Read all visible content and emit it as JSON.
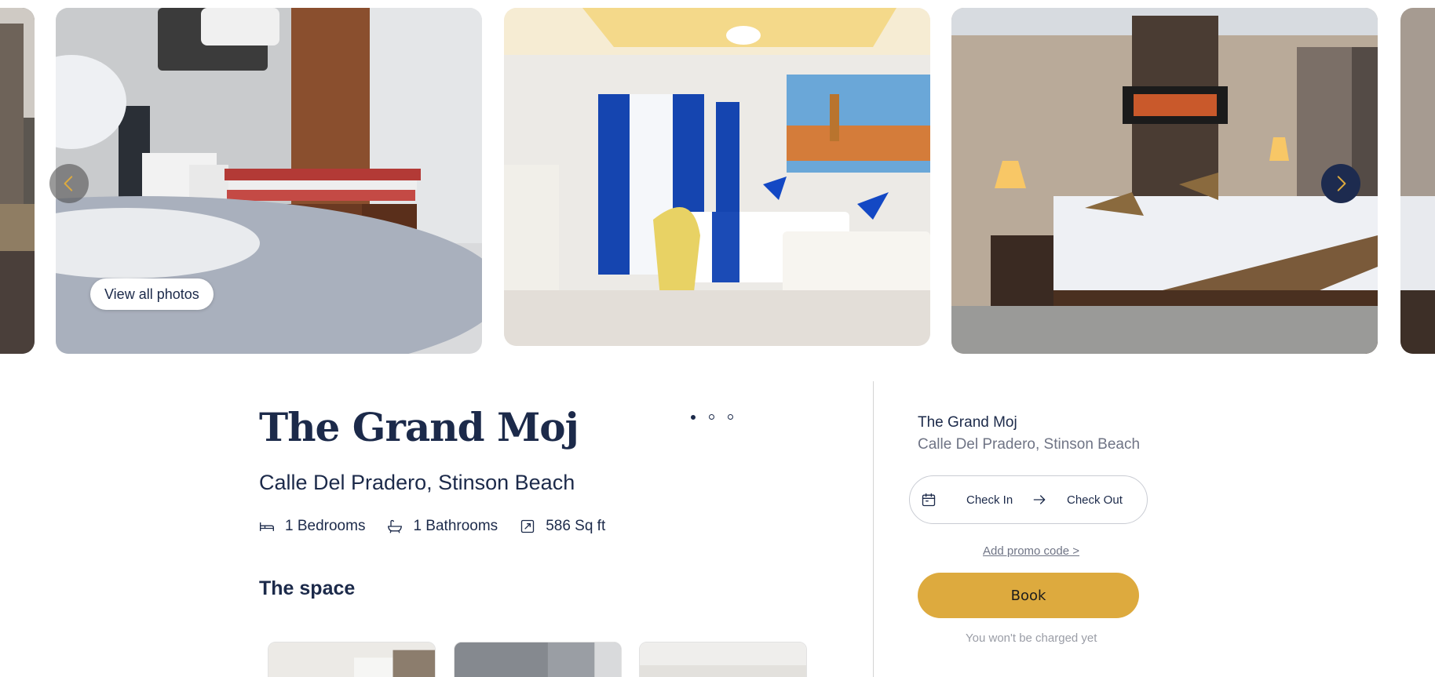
{
  "gallery": {
    "view_all_label": "View all photos",
    "prev_icon": "chevron-left-icon",
    "next_icon": "chevron-right-icon",
    "accent_color": "#ddaa3e",
    "nav_next_color": "#1d2b4f"
  },
  "carousel_dots": {
    "count": 3,
    "active_index": 0
  },
  "hotel": {
    "name": "The Grand Moj",
    "address": "Calle Del Pradero, Stinson Beach",
    "amenities": [
      {
        "icon": "bed-icon",
        "label": "1 Bedrooms"
      },
      {
        "icon": "bathtub-icon",
        "label": "1 Bathrooms"
      },
      {
        "icon": "area-icon",
        "label": "586 Sq ft"
      }
    ]
  },
  "space": {
    "heading": "The space"
  },
  "booking": {
    "name": "The Grand Moj",
    "address": "Calle Del Pradero, Stinson Beach",
    "check_in_label": "Check In",
    "check_out_label": "Check Out",
    "promo_label": "Add promo code >",
    "book_label": "Book",
    "note": "You won't be charged yet",
    "book_color": "#ddaa3e"
  },
  "colors": {
    "text_primary": "#1c2a4a",
    "text_muted": "#6f7485",
    "divider": "#d4d4d4"
  }
}
